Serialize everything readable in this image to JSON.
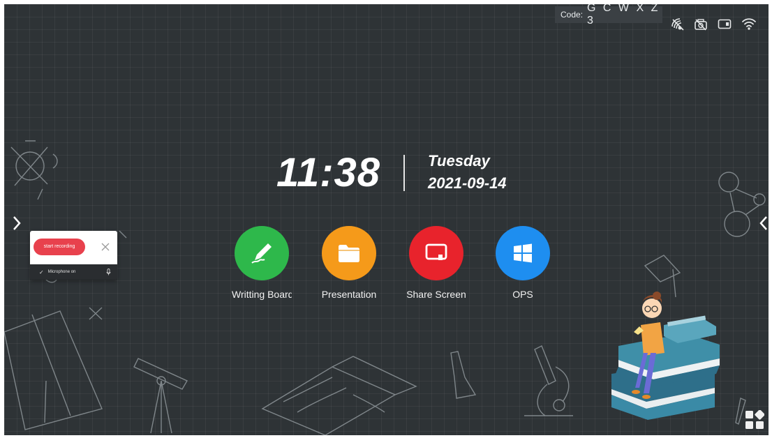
{
  "status_bar": {
    "code_label": "Code:",
    "code_value": "G C W X Z 3",
    "icons": [
      "screen-share-icon",
      "no-camera-icon",
      "input-source-icon",
      "wifi-icon"
    ]
  },
  "clock": {
    "time": "11:38",
    "weekday": "Tuesday",
    "date": "2021-09-14"
  },
  "apps": [
    {
      "label": "Writting Board",
      "icon": "pen-icon",
      "color": "#2eb84b"
    },
    {
      "label": "Presentation",
      "icon": "folder-icon",
      "color": "#f59a1a"
    },
    {
      "label": "Share Screen",
      "icon": "screen-share-icon",
      "color": "#e8232c"
    },
    {
      "label": "OPS",
      "icon": "windows-icon",
      "color": "#1e8ef0"
    }
  ],
  "recording_panel": {
    "start_label": "start recording",
    "mic_status": "Microphone on"
  },
  "colors": {
    "background": "#2e3336",
    "record_red": "#e8414d"
  }
}
